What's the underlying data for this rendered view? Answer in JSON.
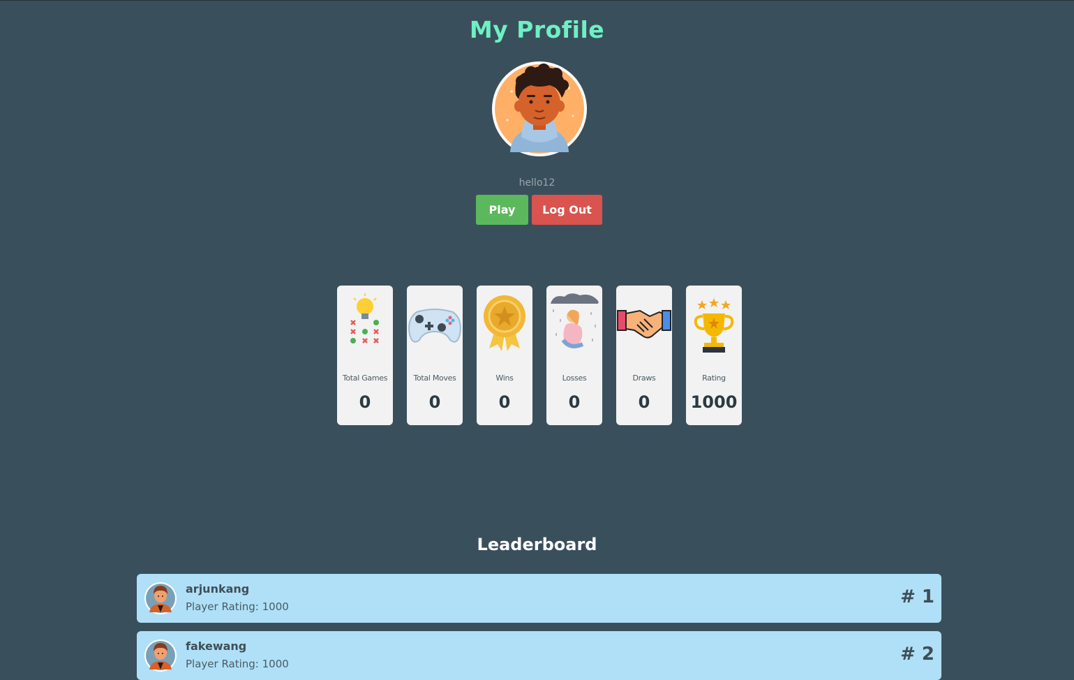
{
  "page": {
    "title": "My Profile"
  },
  "profile": {
    "username": "hello12",
    "avatar_icon": "user-avatar-icon",
    "buttons": {
      "play": "Play",
      "logout": "Log Out"
    }
  },
  "stats": [
    {
      "label": "Total Games",
      "value": "0",
      "icon": "tic-tac-toe-idea-icon"
    },
    {
      "label": "Total Moves",
      "value": "0",
      "icon": "gamepad-icon"
    },
    {
      "label": "Wins",
      "value": "0",
      "icon": "medal-icon"
    },
    {
      "label": "Losses",
      "value": "0",
      "icon": "sad-person-rain-icon"
    },
    {
      "label": "Draws",
      "value": "0",
      "icon": "handshake-icon"
    },
    {
      "label": "Rating",
      "value": "1000",
      "icon": "trophy-icon"
    }
  ],
  "leaderboard": {
    "title": "Leaderboard",
    "entries": [
      {
        "name": "arjunkang",
        "rating": "Player Rating: 1000",
        "rank": "# 1"
      },
      {
        "name": "fakewang",
        "rating": "Player Rating: 1000",
        "rank": "# 2"
      }
    ]
  },
  "colors": {
    "background": "#3a4f5c",
    "title": "#6ef0c4",
    "play": "#5cb85c",
    "logout": "#d9534f",
    "leaderboard_row": "#afe0f8"
  }
}
